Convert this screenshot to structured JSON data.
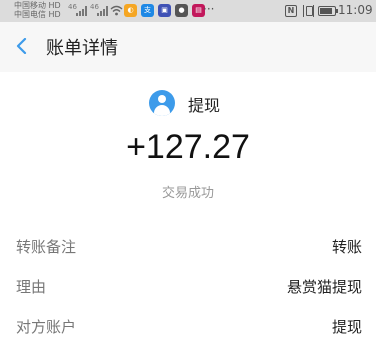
{
  "status_bar": {
    "carriers": [
      "中国移动 HD",
      "中国电信 HD"
    ],
    "signal_labels": [
      "46",
      "46"
    ],
    "app_icons": [
      {
        "name": "photo-app-icon",
        "color": "#f5a623",
        "glyph": "◐"
      },
      {
        "name": "mobile-app-icon",
        "color": "#1e88e5",
        "glyph": "支"
      },
      {
        "name": "app-icon",
        "color": "#3f51b5",
        "glyph": "▣"
      },
      {
        "name": "cat-app-icon",
        "color": "#555555",
        "glyph": "🐾"
      },
      {
        "name": "pink-app-icon",
        "color": "#c2185b",
        "glyph": "▤"
      }
    ],
    "more": "···",
    "nfc": "N",
    "battery_level": 0.85,
    "time": "11:09"
  },
  "app_bar": {
    "title": "账单详情"
  },
  "summary": {
    "type_label": "提现",
    "amount": "+127.27",
    "status": "交易成功",
    "accent_color": "#3d9bea"
  },
  "details": [
    {
      "label": "转账备注",
      "value": "转账"
    },
    {
      "label": "理由",
      "value": "悬赏猫提现"
    },
    {
      "label": "对方账户",
      "value": "提现"
    }
  ]
}
